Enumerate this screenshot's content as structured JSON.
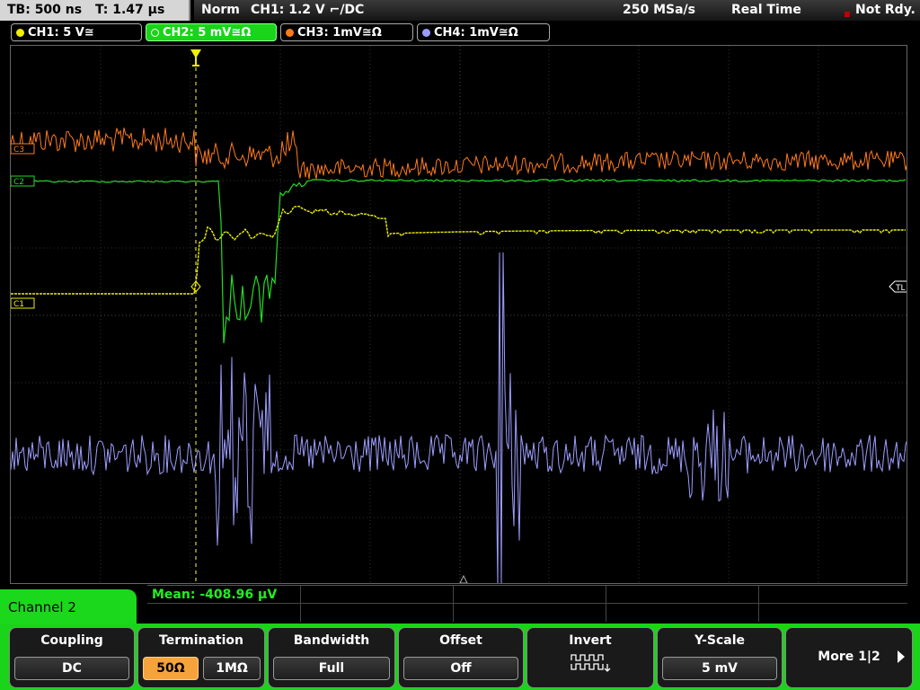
{
  "topbar": {
    "timebase": "TB: 500 ns",
    "trigger_time": "T: 1.47 µs",
    "trigger_mode": "Norm",
    "trigger_source": "CH1: 1.2 V ⌐/DC",
    "sample_rate": "250 MSa/s",
    "acq_mode": "Real Time",
    "state": "Not Rdy."
  },
  "channels": [
    {
      "label": "CH1: 5 V≅",
      "color": "#f0f000"
    },
    {
      "label": "CH2: 5 mV≅Ω",
      "color": "#19d419"
    },
    {
      "label": "CH3: 1mV≅Ω",
      "color": "#ff7a1a"
    },
    {
      "label": "CH4: 1mV≅Ω",
      "color": "#9d9dff"
    }
  ],
  "screen": {
    "markers": {
      "c3": "C3",
      "c2": "C2",
      "c1": "C1",
      "tl": "TL"
    }
  },
  "measurement": {
    "mean": "Mean: -408.96 µV"
  },
  "menu": {
    "channel": "Channel 2",
    "coupling": {
      "title": "Coupling",
      "value": "DC"
    },
    "termination": {
      "title": "Termination",
      "opt1": "50Ω",
      "opt2": "1MΩ"
    },
    "bandwidth": {
      "title": "Bandwidth",
      "value": "Full"
    },
    "offset": {
      "title": "Offset",
      "value": "Off"
    },
    "invert": {
      "title": "Invert"
    },
    "yscale": {
      "title": "Y-Scale",
      "value": "5 mV"
    },
    "more": {
      "title": "More 1|2"
    }
  },
  "colors": {
    "accent": "#19d419",
    "selected": "#f7a33b",
    "status_red": "#c00000"
  }
}
